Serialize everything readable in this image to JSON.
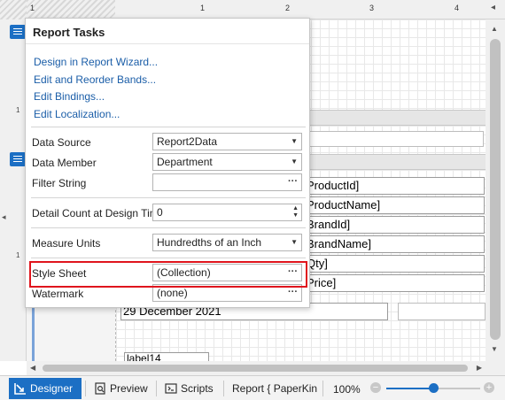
{
  "ruler": {
    "marks": [
      "1",
      "2",
      "3",
      "4"
    ],
    "left_marks": [
      "1",
      "1"
    ]
  },
  "report_fields": [
    "ProductId]",
    "ProductName]",
    "BrandId]",
    "BrandName]",
    "Qty]",
    "Price]"
  ],
  "footer_date": "29 December 2021",
  "footer_label": "label14",
  "popup": {
    "title": "Report Tasks",
    "links": [
      "Design in Report Wizard...",
      "Edit and Reorder Bands...",
      "Edit Bindings...",
      "Edit Localization..."
    ],
    "data_source": {
      "label": "Data Source",
      "value": "Report2Data"
    },
    "data_member": {
      "label": "Data Member",
      "value": "Department"
    },
    "filter_string": {
      "label": "Filter String",
      "value": ""
    },
    "detail_count": {
      "label": "Detail Count at Design Time",
      "value": "0"
    },
    "measure_units": {
      "label": "Measure Units",
      "value": "Hundredths of an Inch"
    },
    "style_sheet": {
      "label": "Style Sheet",
      "value": "(Collection)"
    },
    "watermark": {
      "label": "Watermark",
      "value": "(none)"
    },
    "ellipsis": "···",
    "highlight_color": "#e0151d"
  },
  "bottom": {
    "designer": "Designer",
    "preview": "Preview",
    "scripts": "Scripts",
    "report_tab": "Report { PaperKinc",
    "zoom": "100%",
    "zoom_level_percent": 50
  },
  "colors": {
    "accent": "#1c6fc4",
    "link": "#1b5ea8"
  }
}
